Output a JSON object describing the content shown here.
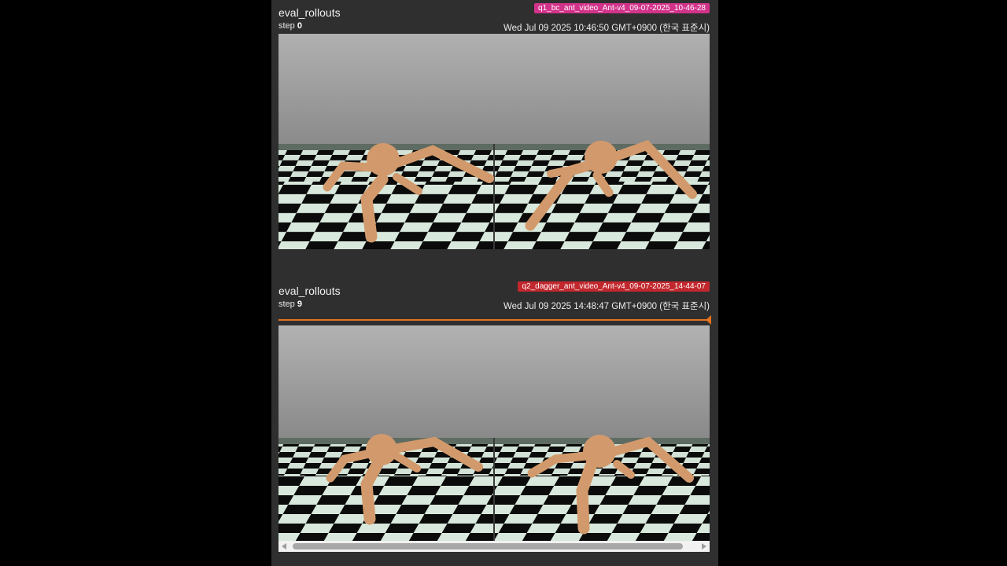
{
  "cards": [
    {
      "title": "eval_rollouts",
      "step_label": "step",
      "step_value": "0",
      "run_name": "q1_bc_ant_video_Ant-v4_09-07-2025_10-46-28",
      "run_color": "#d2338a",
      "timestamp": "Wed Jul 09 2025 10:46:50 GMT+0900 (한국 표준시)"
    },
    {
      "title": "eval_rollouts",
      "step_label": "step",
      "step_value": "9",
      "run_name": "q2_dagger_ant_video_Ant-v4_09-07-2025_14-44-07",
      "run_color": "#c1272d",
      "timestamp": "Wed Jul 09 2025 14:48:47 GMT+0900 (한국 표준시)",
      "step_slider_fraction": 1.0
    }
  ],
  "colors": {
    "panel_bg": "#2f2f2f",
    "slider_accent": "#e8731f",
    "ant_body": "#d29a6c"
  }
}
